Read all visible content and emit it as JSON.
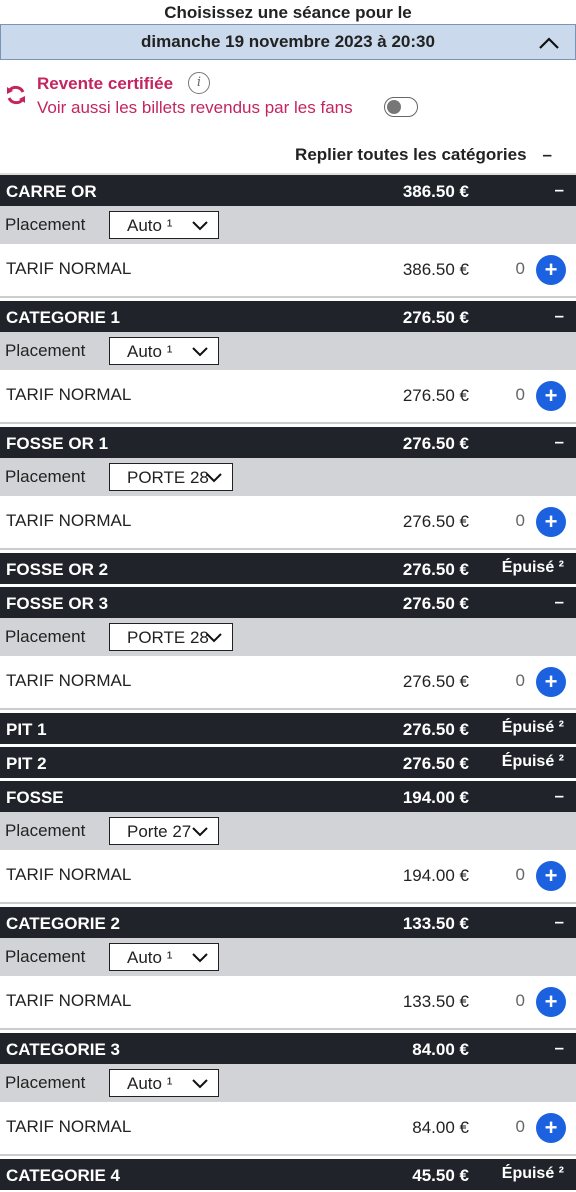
{
  "header": {
    "title": "Choisissez une séance pour le",
    "date": "dimanche 19 novembre 2023 à 20:30"
  },
  "resale": {
    "title": "Revente certifiée",
    "info": "i",
    "subtitle": "Voir aussi les billets revendus par les fans",
    "toggle_on": false,
    "accent_color": "#c4255f"
  },
  "collapse_all": {
    "label": "Replier toutes les catégories",
    "sign": "–"
  },
  "placement_label": "Placement",
  "categories": [
    {
      "name": "CARRE OR",
      "price": "386.50 €",
      "sign": "–",
      "placement": "Auto ¹",
      "tarif": "TARIF NORMAL",
      "tarif_price": "386.50 €",
      "qty": "0",
      "plus": "+"
    },
    {
      "name": "CATEGORIE 1",
      "price": "276.50 €",
      "sign": "–",
      "placement": "Auto ¹",
      "tarif": "TARIF NORMAL",
      "tarif_price": "276.50 €",
      "qty": "0",
      "plus": "+"
    },
    {
      "name": "FOSSE OR 1",
      "price": "276.50 €",
      "sign": "–",
      "placement": "PORTE 28",
      "tarif": "TARIF NORMAL",
      "tarif_price": "276.50 €",
      "qty": "0",
      "plus": "+"
    },
    {
      "name": "FOSSE OR 2",
      "price": "276.50 €",
      "status": "Épuisé ²"
    },
    {
      "name": "FOSSE OR 3",
      "price": "276.50 €",
      "sign": "–",
      "placement": "PORTE 28",
      "tarif": "TARIF NORMAL",
      "tarif_price": "276.50 €",
      "qty": "0",
      "plus": "+"
    },
    {
      "name": "PIT 1",
      "price": "276.50 €",
      "status": "Épuisé ²"
    },
    {
      "name": "PIT 2",
      "price": "276.50 €",
      "status": "Épuisé ²"
    },
    {
      "name": "FOSSE",
      "price": "194.00 €",
      "sign": "–",
      "placement": "Porte 27",
      "tarif": "TARIF NORMAL",
      "tarif_price": "194.00 €",
      "qty": "0",
      "plus": "+"
    },
    {
      "name": "CATEGORIE 2",
      "price": "133.50 €",
      "sign": "–",
      "placement": "Auto ¹",
      "tarif": "TARIF NORMAL",
      "tarif_price": "133.50 €",
      "qty": "0",
      "plus": "+"
    },
    {
      "name": "CATEGORIE 3",
      "price": "84.00 €",
      "sign": "–",
      "placement": "Auto ¹",
      "tarif": "TARIF NORMAL",
      "tarif_price": "84.00 €",
      "qty": "0",
      "plus": "+"
    },
    {
      "name": "CATEGORIE 4",
      "price": "45.50 €",
      "status": "Épuisé ²"
    }
  ]
}
